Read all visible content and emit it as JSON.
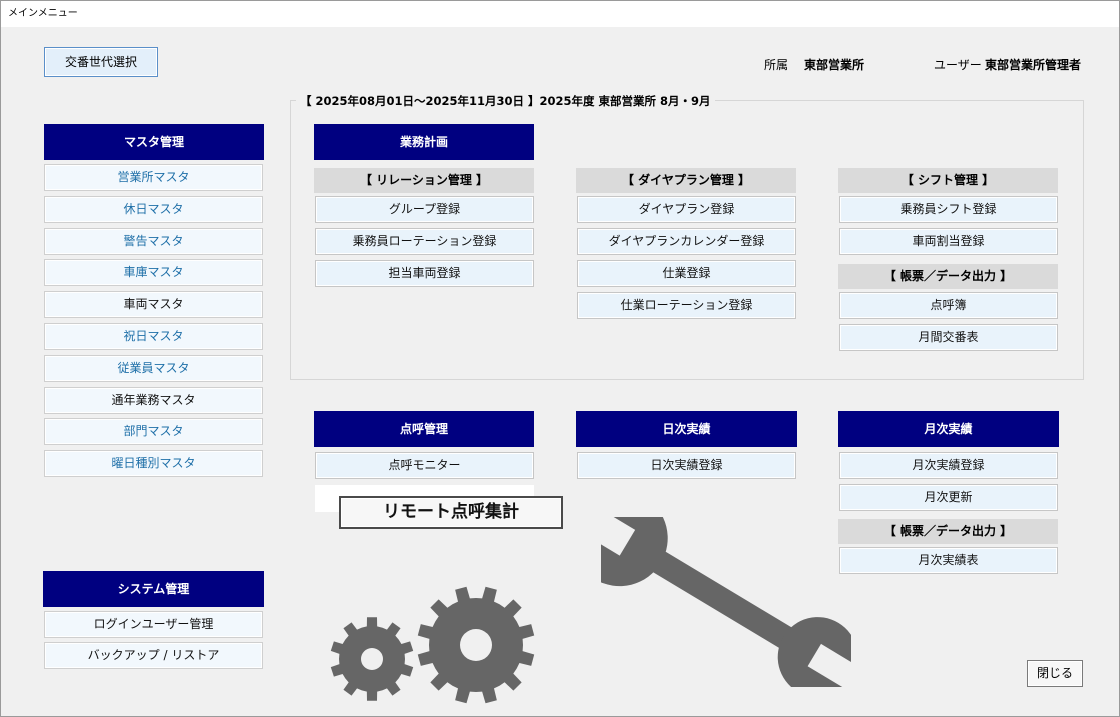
{
  "window": {
    "title": "メインメニュー"
  },
  "header": {
    "shift_select_button": "交番世代選択",
    "affiliation_label": "所属",
    "affiliation_value": "東部営業所",
    "user_label": "ユーザー",
    "user_value": "東部営業所管理者"
  },
  "period": {
    "text": "【 2025年08月01日～2025年11月30日 】2025年度 東部営業所  8月・9月"
  },
  "master": {
    "title": "マスタ管理",
    "items": [
      {
        "label": "営業所マスタ",
        "color": "#1e6fa8"
      },
      {
        "label": "休日マスタ",
        "color": "#1e6fa8"
      },
      {
        "label": "警告マスタ",
        "color": "#1e6fa8"
      },
      {
        "label": "車庫マスタ",
        "color": "#1e6fa8"
      },
      {
        "label": "車両マスタ",
        "color": "#111111"
      },
      {
        "label": "祝日マスタ",
        "color": "#1e6fa8"
      },
      {
        "label": "従業員マスタ",
        "color": "#1e6fa8"
      },
      {
        "label": "通年業務マスタ",
        "color": "#111111"
      },
      {
        "label": "部門マスタ",
        "color": "#1e6fa8"
      },
      {
        "label": "曜日種別マスタ",
        "color": "#1e6fa8"
      }
    ]
  },
  "system": {
    "title": "システム管理",
    "items": [
      "ログインユーザー管理",
      "バックアップ / リストア"
    ]
  },
  "business_plan": {
    "title": "業務計画",
    "relation": {
      "title": "【 リレーション管理 】",
      "items": [
        "グループ登録",
        "乗務員ローテーション登録",
        "担当車両登録"
      ]
    },
    "diagram": {
      "title": "【 ダイヤプラン管理 】",
      "items": [
        "ダイヤプラン登録",
        "ダイヤプランカレンダー登録",
        "仕業登録",
        "仕業ローテーション登録"
      ]
    },
    "shift": {
      "title": "【 シフト管理 】",
      "items": [
        "乗務員シフト登録",
        "車両割当登録"
      ]
    },
    "report": {
      "title": "【 帳票／データ出力 】",
      "items": [
        "点呼簿",
        "月間交番表"
      ]
    }
  },
  "roll_call": {
    "title": "点呼管理",
    "items": [
      "点呼モニター"
    ],
    "remote_button": "リモート点呼集計"
  },
  "daily": {
    "title": "日次実績",
    "items": [
      "日次実績登録"
    ]
  },
  "monthly": {
    "title": "月次実績",
    "items": [
      "月次実績登録",
      "月次更新"
    ],
    "report_title": "【 帳票／データ出力 】",
    "report_items": [
      "月次実績表"
    ]
  },
  "footer": {
    "close_button": "閉じる"
  },
  "colors": {
    "navy": "#000080",
    "gear": "#666666"
  }
}
